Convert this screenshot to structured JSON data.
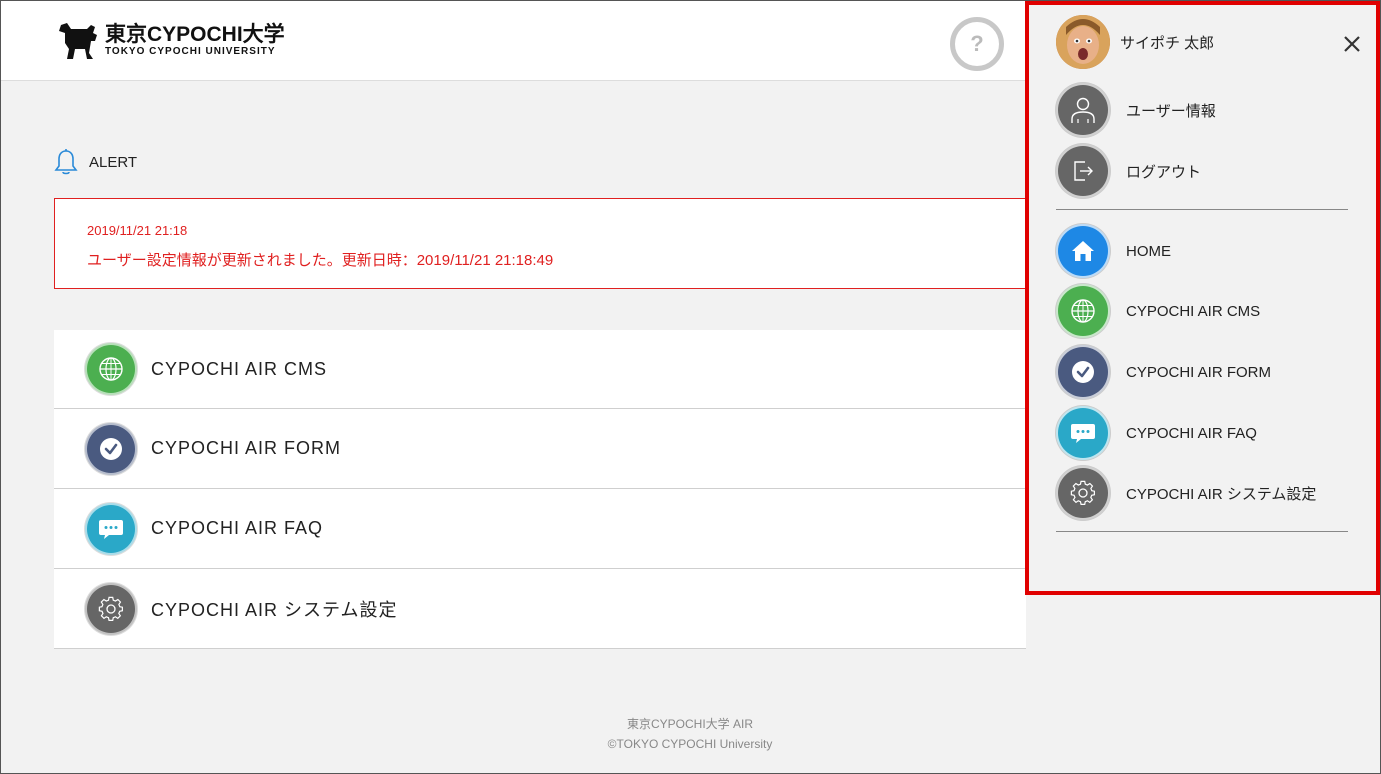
{
  "header": {
    "logo_main": "東京CYPOCHI大学",
    "logo_sub": "TOKYO CYPOCHI UNIVERSITY",
    "help_label": "?"
  },
  "alert": {
    "title": "ALERT",
    "date": "2019/11/21 21:18",
    "message": "ユーザー設定情報が更新されました。更新日時：2019/11/21 21:18:49",
    "color": "#e02020"
  },
  "apps": [
    {
      "label": "CYPOCHI AIR CMS",
      "icon": "globe-icon",
      "color": "#4caf50"
    },
    {
      "label": "CYPOCHI AIR FORM",
      "icon": "check-icon",
      "color": "#4a5a80"
    },
    {
      "label": "CYPOCHI AIR FAQ",
      "icon": "chat-icon",
      "color": "#2aa8c8"
    },
    {
      "label": "CYPOCHI AIR システム設定",
      "icon": "gear-icon",
      "color": "#666666"
    }
  ],
  "footer": {
    "line1": "東京CYPOCHI大学 AIR",
    "line2": "©TOKYO CYPOCHI University"
  },
  "panel": {
    "user_name": "サイポチ 太郎",
    "user_info": "ユーザー情報",
    "logout": "ログアウト",
    "home": "HOME",
    "cms": "CYPOCHI AIR CMS",
    "form": "CYPOCHI AIR FORM",
    "faq": "CYPOCHI AIR FAQ",
    "settings": "CYPOCHI AIR システム設定",
    "highlight_color": "#e00000"
  }
}
